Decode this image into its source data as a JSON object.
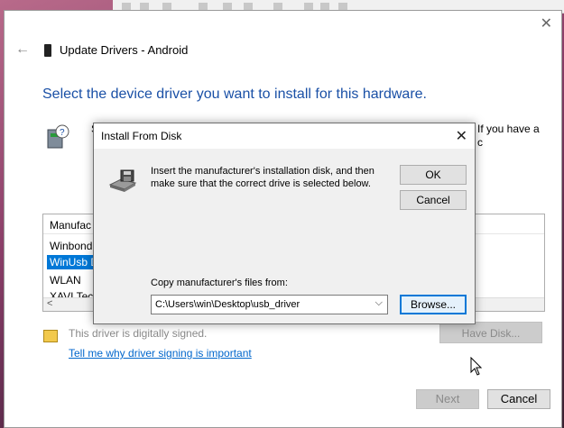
{
  "wizard": {
    "title": "Update Drivers - Android",
    "heading": "Select the device driver you want to install for this hardware.",
    "instructions_fragment_left": "S",
    "instructions_fragment_right_1": "If you have a",
    "instructions_fragment_right_2": "c",
    "list": {
      "header": "Manufac",
      "rows": [
        "Winbond",
        "WinUsb D",
        "WLAN",
        "XAVI Tech"
      ],
      "selected_index": 1
    },
    "signed_text": "This driver is digitally signed.",
    "signing_link": "Tell me why driver signing is important",
    "have_disk_label": "Have Disk...",
    "next_label": "Next",
    "cancel_label": "Cancel"
  },
  "dialog": {
    "title": "Install From Disk",
    "instructions": "Insert the manufacturer's installation disk, and then make sure that the correct drive is selected below.",
    "ok_label": "OK",
    "cancel_label": "Cancel",
    "copy_label": "Copy manufacturer's files from:",
    "path_value": "C:\\Users\\win\\Desktop\\usb_driver",
    "browse_label": "Browse..."
  },
  "colors": {
    "accent": "#0078d7",
    "heading": "#1a50a6",
    "link": "#0066cc"
  }
}
